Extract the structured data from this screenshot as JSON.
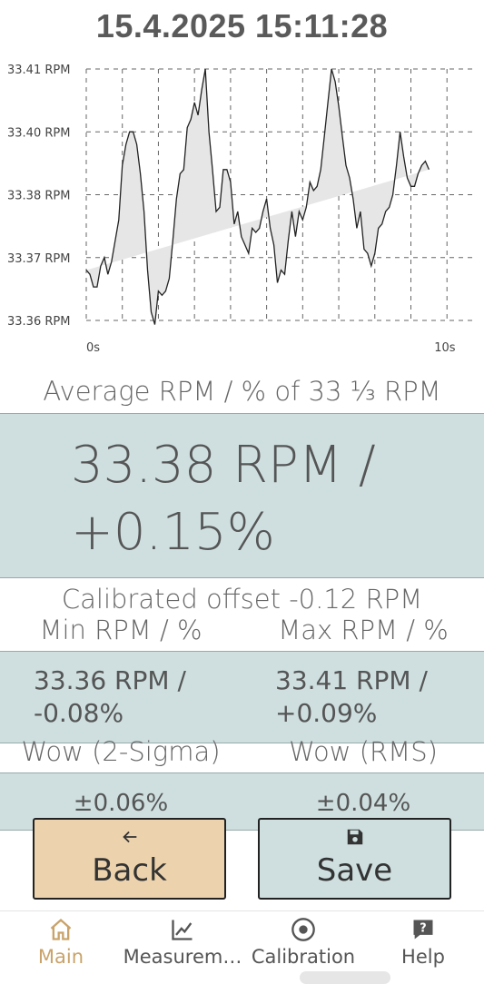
{
  "timestamp": "15.4.2025 15:11:28",
  "chart_data": {
    "type": "area",
    "title": "",
    "xlabel": "",
    "ylabel": "",
    "y_tick_labels": [
      "33.41 RPM",
      "33.40 RPM",
      "33.38 RPM",
      "33.37 RPM",
      "33.36 RPM"
    ],
    "y_tick_values": [
      33.41,
      33.395,
      33.38,
      33.365,
      33.35
    ],
    "x_tick_labels": [
      "0s",
      "10s"
    ],
    "x_tick_values": [
      0,
      10
    ],
    "xlim": [
      0,
      10.8
    ],
    "ylim": [
      33.35,
      33.41
    ],
    "grid": true,
    "fill_color": "#e6e6e6",
    "line_color": "#222222",
    "x": [
      0,
      0.1,
      0.2,
      0.3,
      0.4,
      0.5,
      0.6,
      0.7,
      0.8,
      0.9,
      1.0,
      1.1,
      1.2,
      1.3,
      1.4,
      1.5,
      1.6,
      1.7,
      1.8,
      1.9,
      2.0,
      2.1,
      2.2,
      2.3,
      2.4,
      2.5,
      2.6,
      2.7,
      2.8,
      2.9,
      3.0,
      3.1,
      3.2,
      3.3,
      3.4,
      3.5,
      3.6,
      3.7,
      3.8,
      3.9,
      4.0,
      4.1,
      4.2,
      4.3,
      4.4,
      4.5,
      4.6,
      4.7,
      4.8,
      4.9,
      5.0,
      5.1,
      5.2,
      5.3,
      5.4,
      5.5,
      5.6,
      5.7,
      5.8,
      5.9,
      6.0,
      6.1,
      6.2,
      6.3,
      6.4,
      6.5,
      6.6,
      6.7,
      6.8,
      6.9,
      7.0,
      7.1,
      7.2,
      7.3,
      7.4,
      7.5,
      7.6,
      7.7,
      7.8,
      7.9,
      8.0,
      8.1,
      8.2,
      8.3,
      8.4,
      8.5,
      8.6,
      8.7,
      8.8,
      8.9,
      9.0,
      9.1,
      9.2,
      9.3,
      9.4,
      9.5,
      9.6,
      9.7,
      9.8,
      9.9,
      10.0,
      10.1,
      10.2,
      10.3,
      10.4,
      10.5,
      10.6,
      10.7,
      10.8
    ],
    "y": [
      33.362,
      33.361,
      33.358,
      33.358,
      33.363,
      33.365,
      33.361,
      33.364,
      33.369,
      33.374,
      33.387,
      33.392,
      33.395,
      33.395,
      33.392,
      33.385,
      33.376,
      33.362,
      33.352,
      33.349,
      33.357,
      33.356,
      33.357,
      33.36,
      33.369,
      33.379,
      33.385,
      33.386,
      33.396,
      33.398,
      33.402,
      33.399,
      33.405,
      33.41,
      33.395,
      33.386,
      33.376,
      33.377,
      33.386,
      33.386,
      33.383,
      33.373,
      33.376,
      33.37,
      33.368,
      33.366,
      33.372,
      33.371,
      33.372,
      33.376,
      33.379,
      33.372,
      33.368,
      33.359,
      33.362,
      33.361,
      33.369,
      33.376,
      33.37,
      33.376,
      33.374,
      33.377,
      33.383,
      33.381,
      33.382,
      33.386,
      33.394,
      33.402,
      33.41,
      33.407,
      33.401,
      33.394,
      33.387,
      33.384,
      33.379,
      33.372,
      33.376,
      33.367,
      33.366,
      33.363,
      33.366,
      33.372,
      33.373,
      33.376,
      33.377,
      33.38,
      33.387,
      33.395,
      33.389,
      33.384,
      33.382,
      33.382,
      33.385,
      33.387,
      33.388,
      33.386
    ]
  },
  "avg": {
    "label": "Average RPM / % of 33 ⅓ RPM",
    "line1": "33.38 RPM /",
    "line2": "+0.15%"
  },
  "offset_label": "Calibrated offset  -0.12 RPM",
  "minmax": {
    "min_label": "Min RPM / %",
    "max_label": "Max RPM / %",
    "min_line1": "33.36 RPM /",
    "min_line2": "-0.08%",
    "max_line1": "33.41 RPM /",
    "max_line2": "+0.09%"
  },
  "wow": {
    "sigma_label": "Wow (2-Sigma)",
    "rms_label": "Wow (RMS)",
    "sigma_value": "±0.06%",
    "rms_value": "±0.04%"
  },
  "buttons": {
    "back_label": "Back",
    "save_label": "Save",
    "back_color": "#ecd3ad",
    "save_color": "#cfdfdf"
  },
  "nav": {
    "main": "Main",
    "measurement": "Measurem…",
    "calibration": "Calibration",
    "help": "Help",
    "active_color": "#c9a36a"
  }
}
